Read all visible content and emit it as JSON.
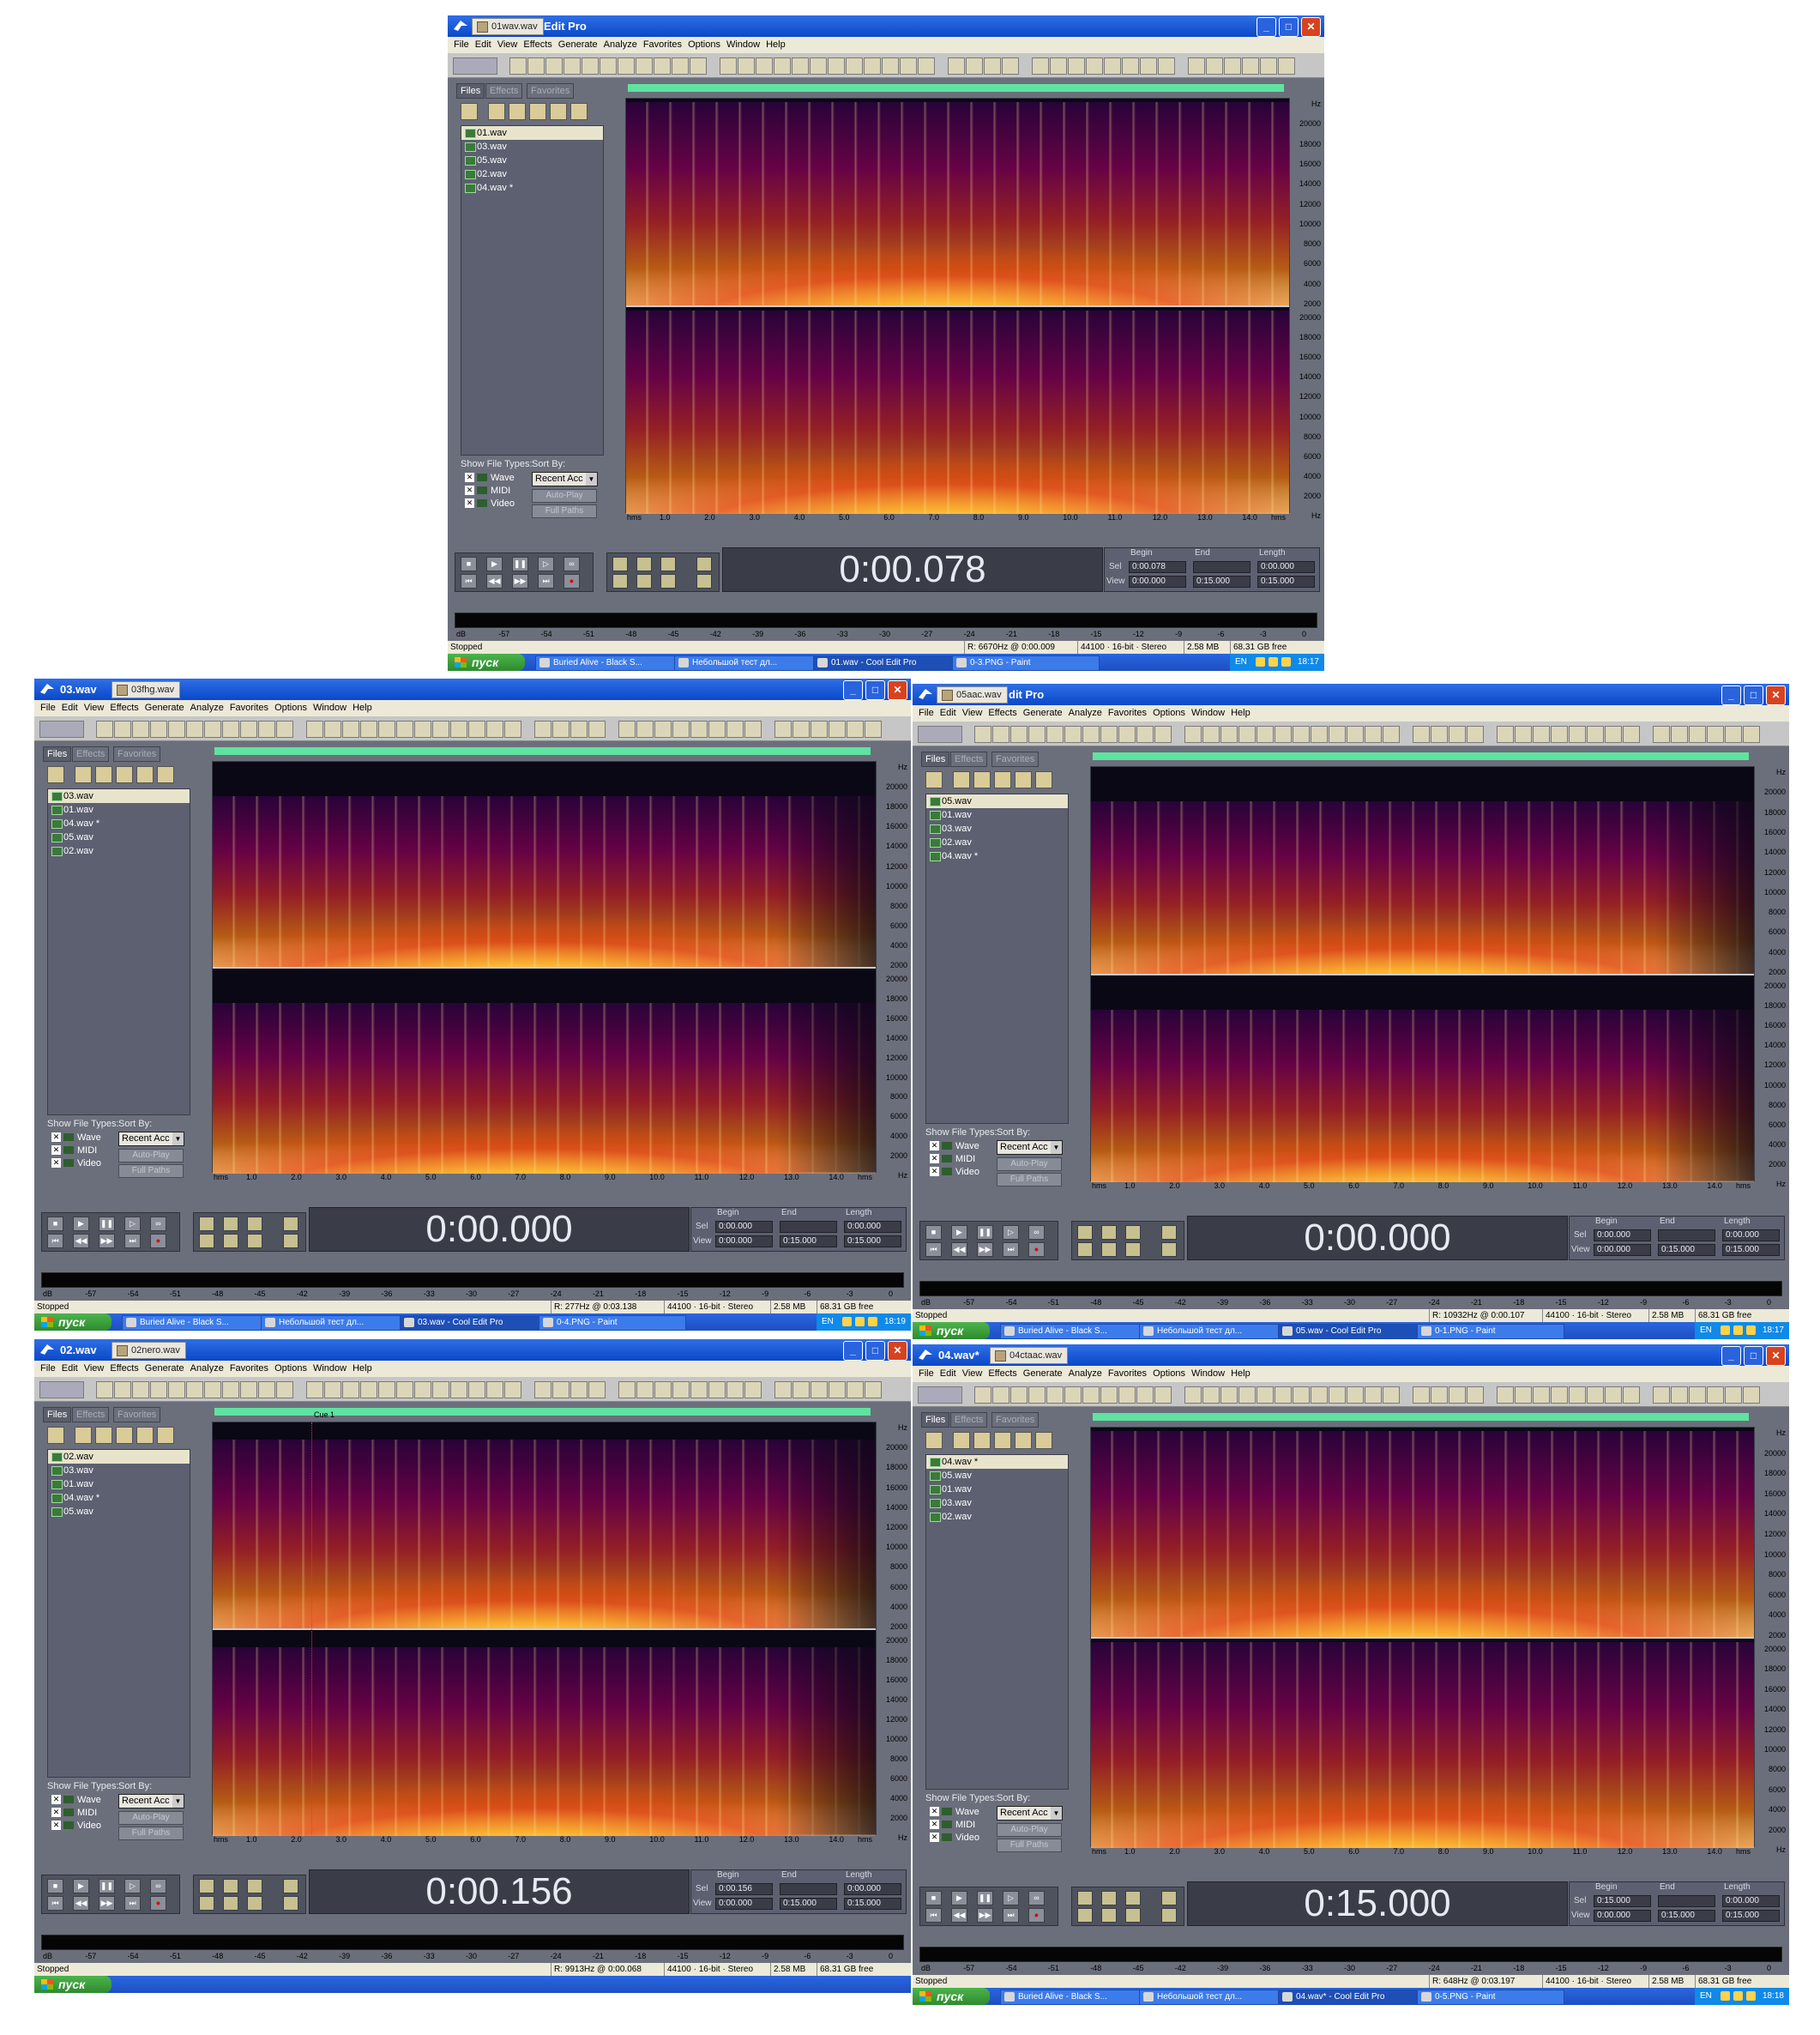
{
  "menu": [
    "File",
    "Edit",
    "View",
    "Effects",
    "Generate",
    "Analyze",
    "Favorites",
    "Options",
    "Window",
    "Help"
  ],
  "panel_tabs": {
    "files": "Files",
    "effects": "Effects",
    "favorites": "Favorites"
  },
  "show_file_types": "Show File Types:",
  "sort_by": "Sort By:",
  "file_types": [
    "Wave",
    "MIDI",
    "Video"
  ],
  "sort_select": "Recent Acc",
  "auto_play": "Auto-Play",
  "full_paths": "Full Paths",
  "sel_labels": {
    "begin": "Begin",
    "end": "End",
    "length": "Length",
    "sel": "Sel",
    "view": "View"
  },
  "hz_ticks": [
    "Hz",
    "20000",
    "18000",
    "16000",
    "14000",
    "12000",
    "10000",
    "8000",
    "6000",
    "4000",
    "2000",
    "Hz"
  ],
  "time_ticks": [
    "hms",
    "1.0",
    "2.0",
    "3.0",
    "4.0",
    "5.0",
    "6.0",
    "7.0",
    "8.0",
    "9.0",
    "10.0",
    "11.0",
    "12.0",
    "13.0",
    "14.0",
    "hms"
  ],
  "db_ticks": [
    "dB",
    "-57",
    "-54",
    "-51",
    "-48",
    "-45",
    "-42",
    "-39",
    "-36",
    "-33",
    "-30",
    "-27",
    "-24",
    "-21",
    "-18",
    "-15",
    "-12",
    "-9",
    "-6",
    "-3",
    "0"
  ],
  "start_label": "пуск",
  "lang": "EN",
  "status_stopped": "Stopped",
  "status_format": "44100 · 16-bit · Stereo",
  "status_size": "2.58 MB",
  "status_free": "68.31 GB free",
  "cue_label": "Cue 1",
  "colors": {
    "title": "#0a48c8",
    "panel": "#6b6f7b",
    "greenbar": "#5fe3a0",
    "menu": "#ece9d8"
  },
  "windows": [
    {
      "title": "Edit Pro",
      "tab_label": "01wav.wav",
      "files": [
        "01.wav",
        "03.wav",
        "05.wav",
        "02.wav",
        "04.wav *"
      ],
      "time": "0:00.078",
      "sel": {
        "begin": "0:00.078",
        "end": "",
        "length": "0:00.000"
      },
      "view": {
        "begin": "0:00.000",
        "end": "0:15.000",
        "length": "0:15.000"
      },
      "status_cursor": "R: 6670Hz @  0:00.009",
      "tasks": [
        "Buried Alive - Black S...",
        "Небольшой тест дл...",
        "01.wav - Cool Edit Pro",
        "0-3.PNG - Paint"
      ],
      "clock": "18:17"
    },
    {
      "title": "03.wav",
      "tab_label": "03fhg.wav",
      "files": [
        "03.wav",
        "01.wav",
        "04.wav *",
        "05.wav",
        "02.wav"
      ],
      "time": "0:00.000",
      "sel": {
        "begin": "0:00.000",
        "end": "",
        "length": "0:00.000"
      },
      "view": {
        "begin": "0:00.000",
        "end": "0:15.000",
        "length": "0:15.000"
      },
      "status_cursor": "R: 277Hz @  0:03.138",
      "tasks": [
        "Buried Alive - Black S...",
        "Небольшой тест дл...",
        "03.wav - Cool Edit Pro",
        "0-4.PNG - Paint"
      ],
      "clock": "18:19"
    },
    {
      "title": "dit Pro",
      "tab_label": "05aac.wav",
      "files": [
        "05.wav",
        "01.wav",
        "03.wav",
        "02.wav",
        "04.wav *"
      ],
      "time": "0:00.000",
      "sel": {
        "begin": "0:00.000",
        "end": "",
        "length": "0:00.000"
      },
      "view": {
        "begin": "0:00.000",
        "end": "0:15.000",
        "length": "0:15.000"
      },
      "status_cursor": "R: 10932Hz @  0:00.107",
      "tasks": [
        "Buried Alive - Black S...",
        "Небольшой тест дл...",
        "05.wav - Cool Edit Pro",
        "0-1.PNG - Paint"
      ],
      "clock": "18:17"
    },
    {
      "title": "02.wav",
      "tab_label": "02nero.wav",
      "files": [
        "02.wav",
        "03.wav",
        "01.wav",
        "04.wav *",
        "05.wav"
      ],
      "time": "0:00.156",
      "sel": {
        "begin": "0:00.156",
        "end": "",
        "length": "0:00.000"
      },
      "view": {
        "begin": "0:00.000",
        "end": "0:15.000",
        "length": "0:15.000"
      },
      "status_cursor": "R: 9913Hz @  0:00.068",
      "tasks": [],
      "clock": ""
    },
    {
      "title": "04.wav*",
      "tab_label": "04ctaac.wav",
      "files": [
        "04.wav *",
        "05.wav",
        "01.wav",
        "03.wav",
        "02.wav"
      ],
      "time": "0:15.000",
      "sel": {
        "begin": "0:15.000",
        "end": "",
        "length": "0:00.000"
      },
      "view": {
        "begin": "0:00.000",
        "end": "0:15.000",
        "length": "0:15.000"
      },
      "status_cursor": "R: 648Hz @  0:03.197",
      "tasks": [
        "Buried Alive - Black S...",
        "Небольшой тест дл...",
        "04.wav* - Cool Edit Pro",
        "0-5.PNG - Paint"
      ],
      "clock": "18:18"
    }
  ]
}
